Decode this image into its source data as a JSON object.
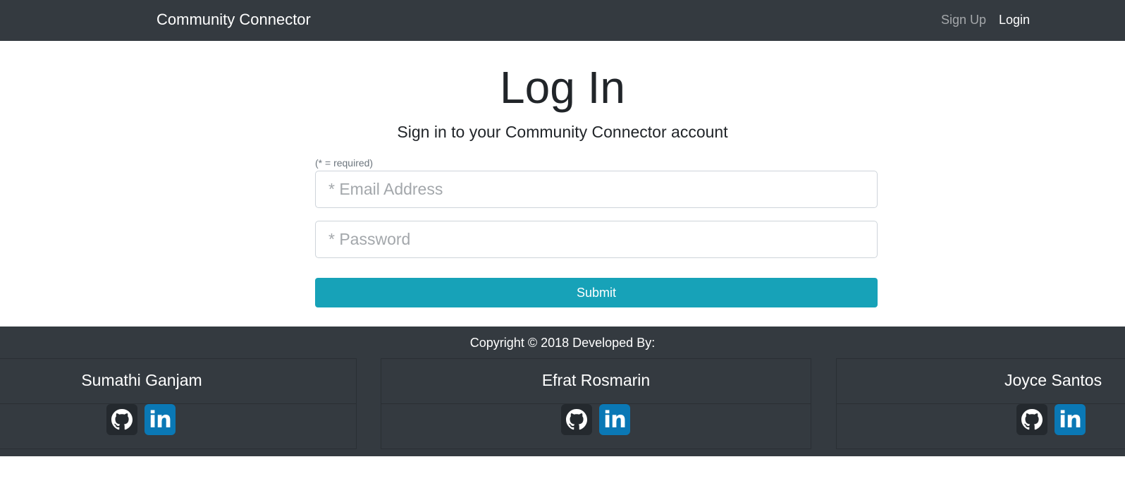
{
  "navbar": {
    "brand": "Community Connector",
    "links": {
      "signup": "Sign Up",
      "login": "Login"
    }
  },
  "main": {
    "title": "Log In",
    "subtitle": "Sign in to your Community Connector account",
    "required_note": "(* = required)",
    "email": {
      "placeholder": "* Email Address",
      "value": ""
    },
    "password": {
      "placeholder": "* Password",
      "value": ""
    },
    "submit_label": "Submit"
  },
  "footer": {
    "copyright": "Copyright © 2018 Developed By:",
    "developers": [
      {
        "name": "Sumathi Ganjam",
        "icons": [
          "github-icon",
          "linkedin-icon"
        ]
      },
      {
        "name": "Efrat Rosmarin",
        "icons": [
          "github-icon",
          "linkedin-icon"
        ]
      },
      {
        "name": "Joyce Santos",
        "icons": [
          "github-icon",
          "linkedin-icon"
        ]
      }
    ],
    "linkedin_glyph": "in"
  },
  "colors": {
    "navbar_bg": "#343a40",
    "accent": "#17a2b8",
    "github_bg": "#24292e",
    "linkedin_bg": "#0a78b5"
  }
}
